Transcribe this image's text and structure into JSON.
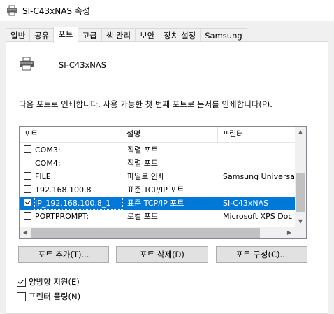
{
  "window": {
    "title": "SI-C43xNAS 속성",
    "icon": "printer-icon"
  },
  "tabs": [
    {
      "label": "일반",
      "active": false
    },
    {
      "label": "공유",
      "active": false
    },
    {
      "label": "포트",
      "active": true
    },
    {
      "label": "고급",
      "active": false
    },
    {
      "label": "색 관리",
      "active": false
    },
    {
      "label": "보안",
      "active": false
    },
    {
      "label": "장치 설정",
      "active": false
    },
    {
      "label": "Samsung",
      "active": false
    }
  ],
  "printer": {
    "name": "SI-C43xNAS",
    "icon": "printer-icon"
  },
  "description": "다음 포트로 인쇄합니다. 사용 가능한 첫 번째 포트로 문서를 인쇄합니다(P).",
  "port_list": {
    "headers": {
      "port": "포트",
      "description": "설명",
      "printer": "프린터"
    },
    "rows": [
      {
        "checked": false,
        "port": "COM3:",
        "description": "직렬 포트",
        "printer": "",
        "selected": false
      },
      {
        "checked": false,
        "port": "COM4:",
        "description": "직렬 포트",
        "printer": "",
        "selected": false
      },
      {
        "checked": false,
        "port": "FILE:",
        "description": "파일로 인쇄",
        "printer": "Samsung Universal",
        "selected": false
      },
      {
        "checked": false,
        "port": "192.168.100.8",
        "description": "표준 TCP/IP 포트",
        "printer": "",
        "selected": false
      },
      {
        "checked": true,
        "port": "IP_192.168.100.8_1",
        "description": "표준 TCP/IP 포트",
        "printer": "SI-C43xNAS",
        "selected": true
      },
      {
        "checked": false,
        "port": "PORTPROMPT:",
        "description": "로컬 포트",
        "printer": "Microsoft XPS Doc",
        "selected": false
      }
    ]
  },
  "buttons": {
    "add_port": "포트 추가(T)...",
    "delete_port": "포트 삭제(D)",
    "configure_port": "포트 구성(C)..."
  },
  "options": {
    "bidirectional": {
      "label": "양방향 지원(E)",
      "checked": true
    },
    "pooling": {
      "label": "프린터 풀링(N)",
      "checked": false
    }
  },
  "colors": {
    "selection": "#0078d7",
    "dialog_bg": "#f0f0f0",
    "panel_bg": "#ffffff"
  }
}
